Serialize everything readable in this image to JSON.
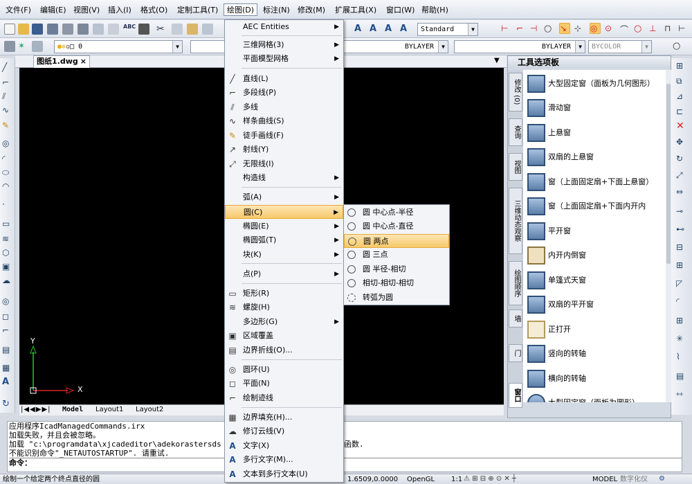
{
  "menubar": {
    "items": [
      "文件(F)",
      "编辑(E)",
      "视图(V)",
      "插入(I)",
      "格式(O)",
      "定制工具(T)",
      "绘图(D)",
      "标注(N)",
      "修改(M)",
      "扩展工具(X)",
      "窗口(W)",
      "帮助(H)"
    ]
  },
  "toolbar": {
    "text_style": "Standard",
    "layer": "0",
    "linetype": "BYLAYER",
    "lineweight": "BYLAYER",
    "color": "BYCOLOR"
  },
  "doc_tab": {
    "title": "图纸1.dwg",
    "close": "×"
  },
  "layout_tabs": [
    "Model",
    "Layout1",
    "Layout2"
  ],
  "ucs": {
    "x": "X",
    "y": "Y"
  },
  "draw_menu": {
    "items": [
      {
        "label": "AEC Entities",
        "sub": true
      },
      {
        "label": "三维网格(3)",
        "sub": true
      },
      {
        "label": "平面模型网格",
        "sub": true
      },
      {
        "label": "直线(L)",
        "icon": "line-icon"
      },
      {
        "label": "多段线(P)",
        "icon": "polyline-icon"
      },
      {
        "label": "多线",
        "icon": "multiline-icon"
      },
      {
        "label": "样条曲线(S)",
        "icon": "spline-icon"
      },
      {
        "label": "徒手画线(F)",
        "icon": "sketch-icon"
      },
      {
        "label": "射线(Y)",
        "icon": "ray-icon"
      },
      {
        "label": "无限线(I)",
        "icon": "xline-icon"
      },
      {
        "label": "构造线",
        "sub": true
      },
      {
        "label": "弧(A)",
        "sub": true
      },
      {
        "label": "圆(C)",
        "sub": true
      },
      {
        "label": "椭圆(E)",
        "sub": true
      },
      {
        "label": "椭圆弧(T)",
        "sub": true
      },
      {
        "label": "块(K)",
        "sub": true
      },
      {
        "label": "点(P)",
        "sub": true
      },
      {
        "label": "矩形(R)",
        "icon": "rectangle-icon"
      },
      {
        "label": "螺旋(H)",
        "icon": "helix-icon"
      },
      {
        "label": "多边形(G)",
        "sub": true
      },
      {
        "label": "区域覆盖",
        "icon": "wipeout-icon"
      },
      {
        "label": "边界折线(O)...",
        "icon": "boundary-icon"
      },
      {
        "label": "圆环(U)",
        "icon": "donut-icon"
      },
      {
        "label": "平面(N)",
        "icon": "plane-icon"
      },
      {
        "label": "绘制迹线",
        "icon": "trace-icon"
      },
      {
        "label": "边界填充(H)...",
        "icon": "hatch-icon"
      },
      {
        "label": "修订云线(V)",
        "icon": "revcloud-icon"
      },
      {
        "label": "文字(X)",
        "icon": "text-icon"
      },
      {
        "label": "多行文字(M)...",
        "icon": "mtext-icon"
      },
      {
        "label": "文本到多行文本(U)",
        "icon": "text-to-mtext-icon"
      }
    ]
  },
  "circle_submenu": {
    "items": [
      "圆 中心点-半径",
      "圆 中心点-直径",
      "圆 两点",
      "圆 三点",
      "圆 半径-相切",
      "相切-相切-相切",
      "转弧为圆"
    ]
  },
  "palette": {
    "title": "工具选项板",
    "tabs": [
      "修改 (0)",
      "查询",
      "视图",
      "三维动态观察",
      "绘图顺序",
      "墙",
      "门",
      "窗口"
    ],
    "items": [
      "大型固定窗（面板为几何图形）",
      "滑动窗",
      "上悬窗",
      "双扇的上悬窗",
      "窗（上面固定扇+下面上悬窗）",
      "窗（上面固定扇+下面内开内",
      "平开窗",
      "内开内倒窗",
      "单篷式天窗",
      "双扇的平开窗",
      "正打开",
      "竖向的转轴",
      "横向的转轴",
      "大型固定窗（面板为圆形）"
    ]
  },
  "command": {
    "lines": [
      "应用程序IcadManagedCommands.irx",
      "加载失败，并且会被忽略。",
      "加载 \"c:\\programdata\\xjcadeditor\\adekorastersds",
      "不能识别命令\"_NETAUTOSTARTUP\". 请重试."
    ],
    "tail": "函数.",
    "prompt": "命令："
  },
  "status": {
    "hint": "绘制一个给定两个终点直径的圆",
    "coords": "1.6509,0.0000",
    "render": "OpenGL",
    "scale": "1:1",
    "model": "MODEL",
    "extra": "数字化仪"
  }
}
